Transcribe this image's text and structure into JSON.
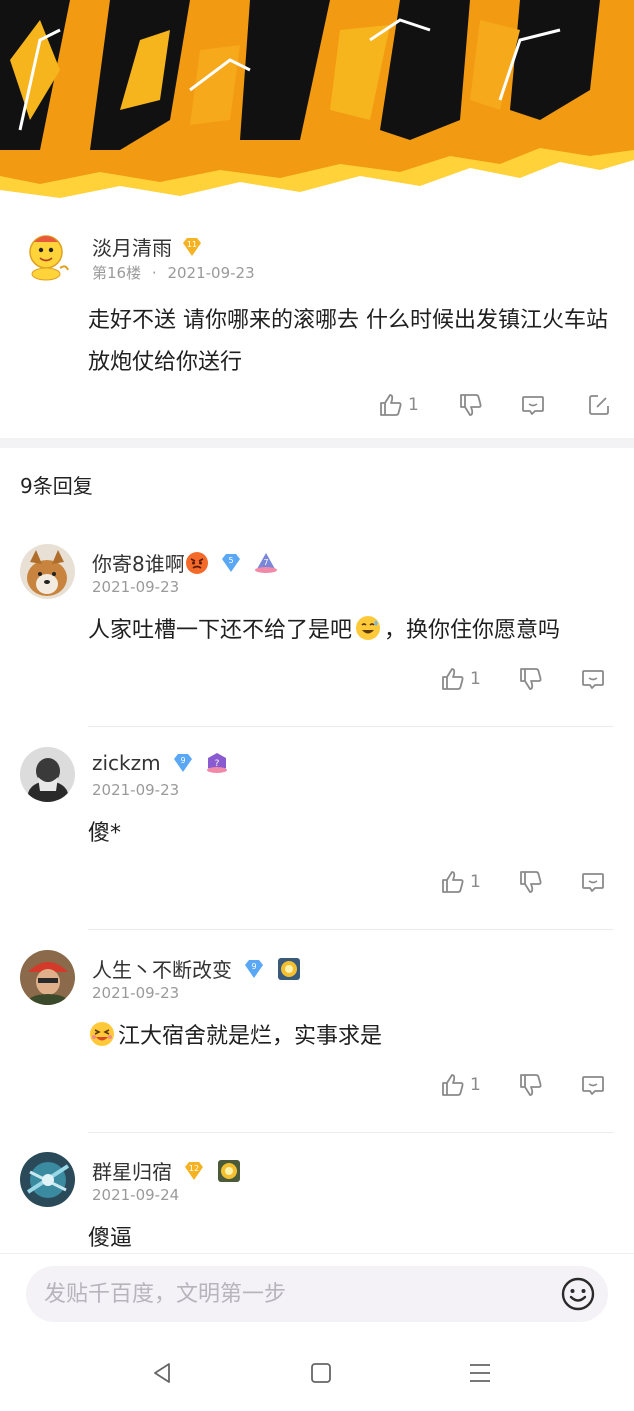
{
  "main_post": {
    "author": "淡月清雨",
    "level": "11",
    "floor": "第16楼",
    "dot": "·",
    "date": "2021-09-23",
    "text": "走好不送 请你哪来的滚哪去 什么时候出发镇江火车站放炮仗给你送行",
    "like_count": "1"
  },
  "replies_header": "9条回复",
  "replies": [
    {
      "author": "你寄8谁啊",
      "level": "5",
      "date": "2021-09-23",
      "text": "人家吐槽一下还不给了是吧",
      "text_after": "，换你住你愿意吗",
      "like_count": "1"
    },
    {
      "author": "zickzm",
      "level": "9",
      "date": "2021-09-23",
      "text": "傻*",
      "like_count": "1"
    },
    {
      "author": "人生丶不断改变",
      "level": "9",
      "date": "2021-09-23",
      "text": "江大宿舍就是烂，实事求是",
      "like_count": "1"
    },
    {
      "author": "群星归宿",
      "level": "12",
      "date": "2021-09-24",
      "text": "傻逼"
    }
  ],
  "input": {
    "placeholder": "发贴千百度，文明第一步"
  },
  "icons": {
    "like": "thumbs-up-icon",
    "dislike": "thumbs-down-icon",
    "comment": "comment-icon",
    "edit": "edit-icon",
    "emoji": "smiley-icon",
    "back": "back-triangle-icon",
    "home": "home-square-icon",
    "menu": "menu-lines-icon"
  },
  "colors": {
    "banner_orange": "#f29a12",
    "banner_yellow": "#ffd23a",
    "badge_gold": "#f5b324",
    "badge_blue": "#5aa7f5",
    "muted_text": "#9a9a9a"
  }
}
